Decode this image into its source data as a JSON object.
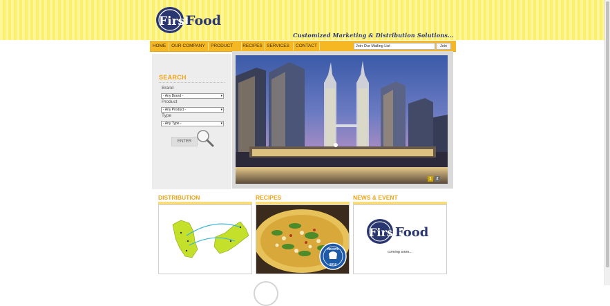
{
  "brand": {
    "logo_prefix": "First",
    "logo_suffix": "Food",
    "tagline": "Customized Marketing & Distribution Solutions..."
  },
  "nav": {
    "items": [
      {
        "label": "HOME"
      },
      {
        "label": "OUR COMPANY"
      },
      {
        "label": "PRODUCT"
      },
      {
        "label": "RECIPES"
      },
      {
        "label": "SERVICES"
      },
      {
        "label": "CONTACT"
      }
    ],
    "mailing_value": "Join Our Mailing List",
    "join_label": "Join"
  },
  "search": {
    "title": "SEARCH",
    "brand_label": "Brand",
    "brand_value": "- Any Brand -",
    "product_label": "Product",
    "product_value": "- Any Product -",
    "type_label": "Type",
    "type_value": "- Any Type -",
    "enter_label": "ENTER"
  },
  "slider": {
    "pages": [
      "1",
      "2"
    ],
    "active_page": "1"
  },
  "sections": {
    "distribution_title": "DISTRIBUTION",
    "recipes_title": "RECIPES",
    "news_title": "NEWS & EVENT",
    "news_text": "coming soon...",
    "recipe_badge_top": "RECIPE",
    "recipe_badge_bottom": "2012"
  },
  "colors": {
    "accent": "#f2a312",
    "nav_bg": "#f6b822",
    "navy": "#2a3670",
    "stripe_light": "#fdf79a",
    "stripe_dark": "#fbef6e"
  }
}
